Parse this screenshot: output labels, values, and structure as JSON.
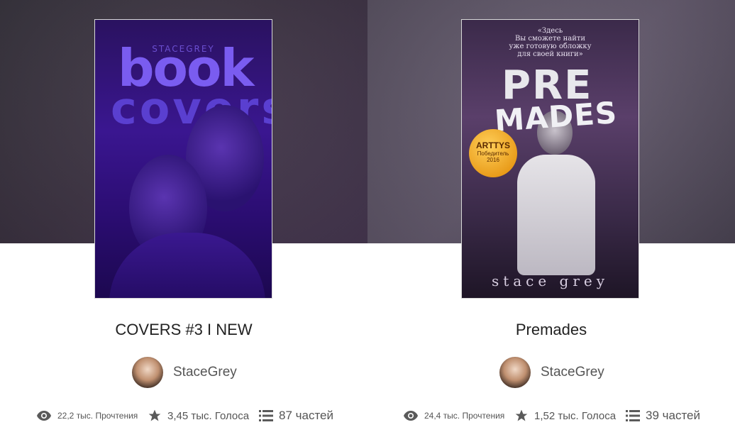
{
  "stories": [
    {
      "title": "COVERS #3 I NEW",
      "cover": {
        "author_mark": "STACEGREY",
        "line1": "book",
        "line2": "covers"
      },
      "author": "StaceGrey",
      "reads": "22,2 тыс. Прочтения",
      "votes": "3,45 тыс. Голоса",
      "parts": "87 частей"
    },
    {
      "title": "Premades",
      "cover": {
        "top_text_1": "«Здесь",
        "top_text_2": "Вы сможете найти",
        "top_text_3": "уже готовую обложку",
        "top_text_4": "для своей книги»",
        "line1": "PRE",
        "line2": "MADES",
        "badge_1": "ARTTYS",
        "badge_2": "Победитель",
        "badge_3": "2016",
        "bottom_text": "stace grey"
      },
      "author": "StaceGrey",
      "reads": "24,4 тыс. Прочтения",
      "votes": "1,52 тыс. Голоса",
      "parts": "39 частей"
    }
  ],
  "icons": {
    "reads": "eye-icon",
    "votes": "star-icon",
    "parts": "list-icon"
  },
  "colors": {
    "text": "#222222",
    "muted": "#555555",
    "left_cover_tint": "#3a1690",
    "right_cover_tint": "#5a3f6a"
  }
}
